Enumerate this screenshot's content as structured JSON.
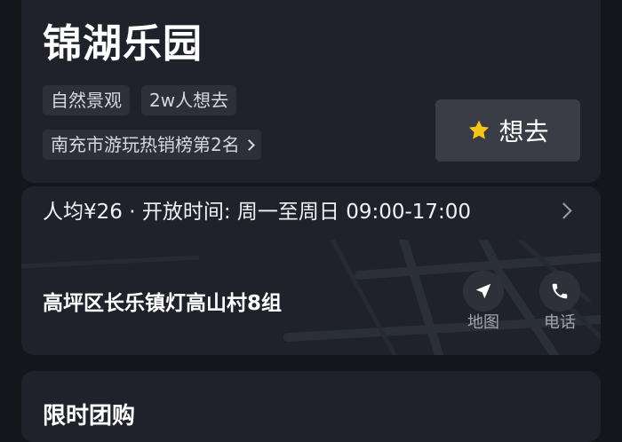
{
  "poi": {
    "name": "锦湖乐园",
    "tags": [
      "自然景观",
      "2w人想去"
    ],
    "ranking": "南充市游玩热销榜第2名",
    "want_label": "想去"
  },
  "info": {
    "price_hours": "人均¥26 · 开放时间: 周一至周日 09:00-17:00",
    "address": "高坪区长乐镇灯高山村8组",
    "map_label": "地图",
    "phone_label": "电话"
  },
  "deals": {
    "title": "限时团购"
  },
  "icons": {
    "want": "star-icon",
    "ranking_more": "chevron-right-icon",
    "info_more": "chevron-right-icon",
    "map": "navigation-arrow-icon",
    "phone": "phone-icon"
  },
  "colors": {
    "background": "#14161c",
    "card": "#1f222b",
    "tag_bg": "#2d3039",
    "star": "#f5c518",
    "button_bg": "#3a3d46"
  }
}
